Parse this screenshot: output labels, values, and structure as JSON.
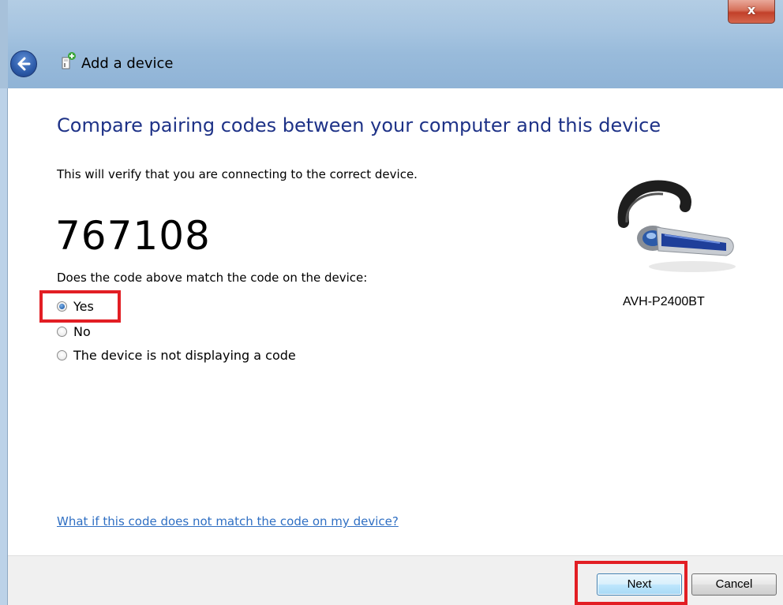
{
  "window": {
    "title": "Add a device",
    "close_label": "x",
    "back_icon": "back-arrow-icon",
    "wizard_icon": "add-device-icon"
  },
  "main": {
    "heading": "Compare pairing codes between your computer and this device",
    "subtitle": "This will verify that you are connecting to the correct device.",
    "pairing_code": "767108",
    "question": "Does the code above match the code on the device:",
    "options": [
      {
        "label": "Yes",
        "selected": true
      },
      {
        "label": "No",
        "selected": false
      },
      {
        "label": "The device is not displaying a code",
        "selected": false
      }
    ],
    "help_link": "What if this code does not match the code on my device?"
  },
  "device": {
    "name": "AVH-P2400BT",
    "icon": "bluetooth-headset-icon"
  },
  "footer": {
    "next_label": "Next",
    "cancel_label": "Cancel"
  },
  "colors": {
    "heading": "#1e3287",
    "link": "#2f6fc3",
    "highlight": "#e21e24"
  }
}
